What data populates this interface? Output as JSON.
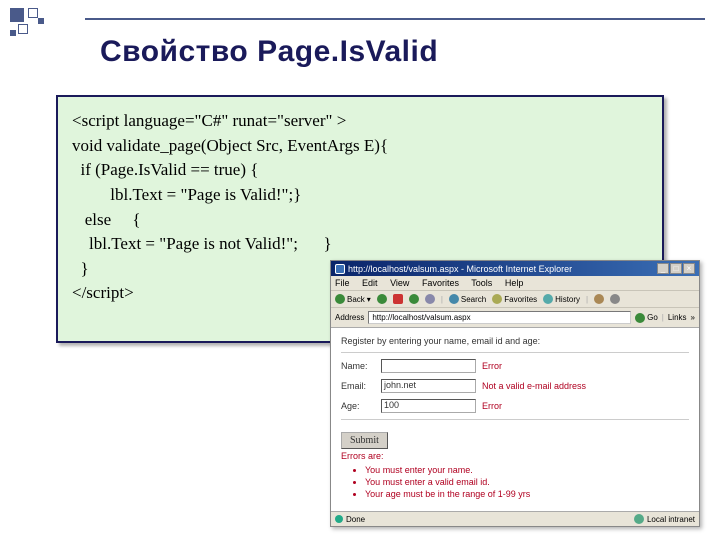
{
  "title": "Свойство Page.IsValid",
  "code": {
    "l1": "<script language=\"C#\" runat=\"server\" >",
    "l2": "void validate_page(Object Src, EventArgs E){",
    "l3": "  if (Page.IsValid == true) {",
    "l4": "         lbl.Text = \"Page is Valid!\";}",
    "l5": "   else     {",
    "l6": "    lbl.Text = \"Page is not Valid!\";      }",
    "l7": "  }",
    "l8": "</script>"
  },
  "browser": {
    "title": "http://localhost/valsum.aspx - Microsoft Internet Explorer",
    "menu": {
      "file": "File",
      "edit": "Edit",
      "view": "View",
      "favorites": "Favorites",
      "tools": "Tools",
      "help": "Help"
    },
    "toolbar": {
      "back": "Back",
      "search": "Search",
      "favorites": "Favorites",
      "history": "History"
    },
    "address_label": "Address",
    "address": "http://localhost/valsum.aspx",
    "go": "Go",
    "links": "Links",
    "page": {
      "heading": "Register by entering your name, email id and age:",
      "name_label": "Name:",
      "name_value": "",
      "name_error": "Error",
      "email_label": "Email:",
      "email_value": "john.net",
      "email_error": "Not a valid e-mail address",
      "age_label": "Age:",
      "age_value": "100",
      "age_error": "Error",
      "submit": "Submit",
      "errors_header": "Errors are:",
      "err1": "You must enter your name.",
      "err2": "You must enter a valid email id.",
      "err3": "Your age must be in the range of 1-99 yrs"
    },
    "status_done": "Done",
    "status_zone": "Local intranet"
  }
}
